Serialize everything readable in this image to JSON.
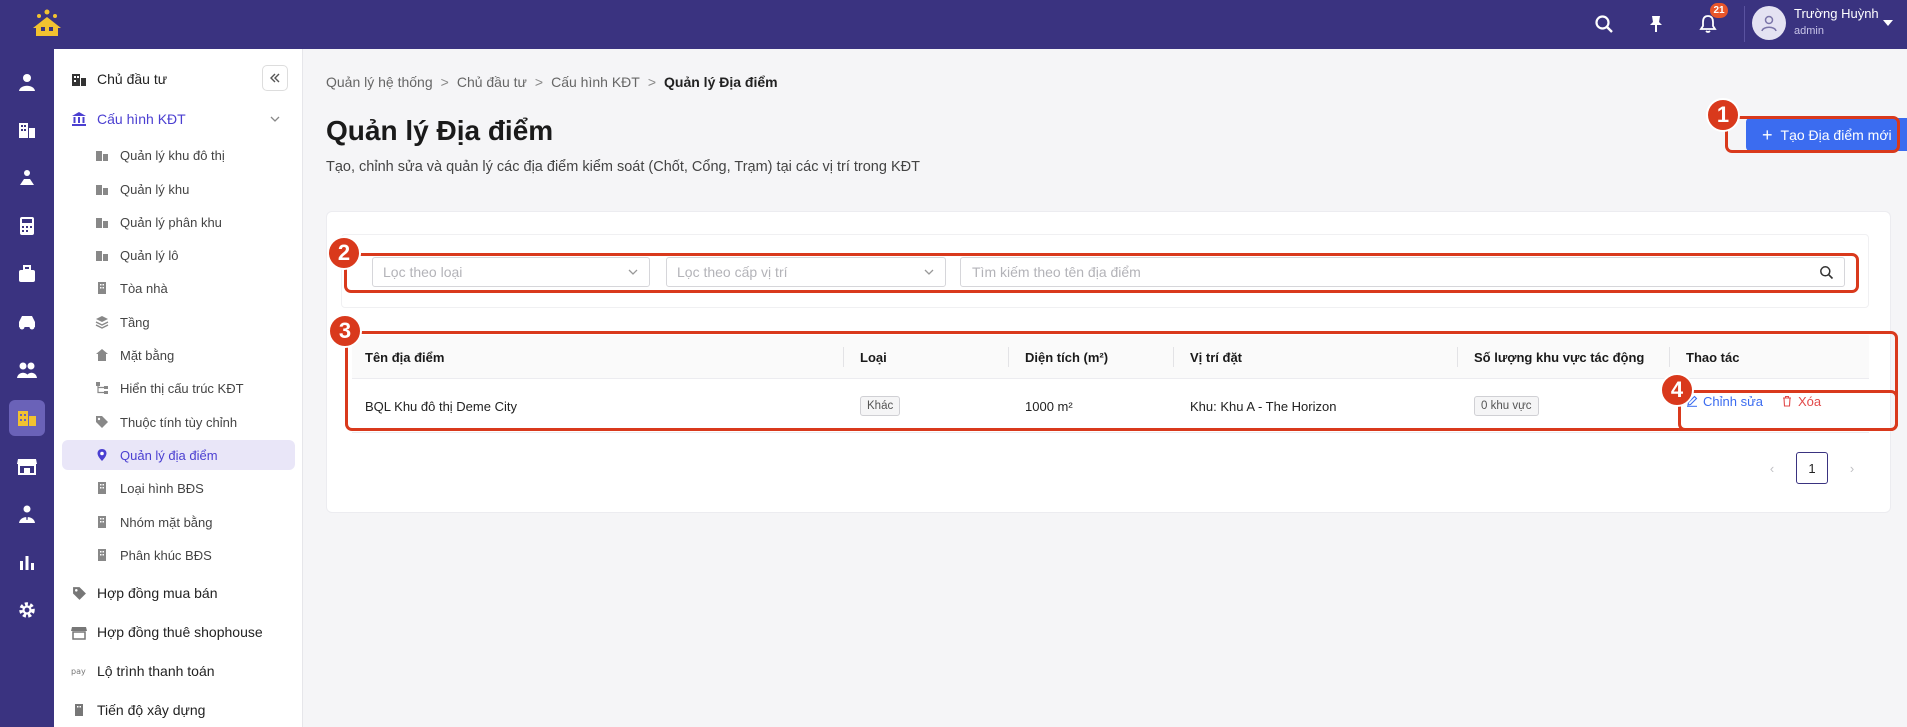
{
  "user": {
    "name": "Trường Huỳnh",
    "role": "admin",
    "notification_count": "21"
  },
  "sidebar": {
    "investor": "Chủ đầu tư",
    "group_label": "Cấu hình KĐT",
    "sub_items": [
      "Quản lý khu đô thị",
      "Quản lý khu",
      "Quản lý phân khu",
      "Quản lý lô",
      "Tòa nhà",
      "Tầng",
      "Mặt bằng",
      "Hiển thị cấu trúc KĐT",
      "Thuộc tính tùy chỉnh",
      "Quản lý địa điểm",
      "Loại hình BĐS",
      "Nhóm mặt bằng",
      "Phân khúc BĐS"
    ],
    "bottom_items": [
      "Hợp đồng mua bán",
      "Hợp đồng thuê shophouse",
      "Lộ trình thanh toán",
      "Tiến độ xây dựng"
    ]
  },
  "breadcrumb": [
    "Quản lý hệ thống",
    "Chủ đầu tư",
    "Cấu hình KĐT",
    "Quản lý Địa điểm"
  ],
  "breadcrumb_sep": ">",
  "page": {
    "title": "Quản lý Địa điểm",
    "description": "Tạo, chỉnh sửa và quản lý các địa điểm kiểm soát (Chốt, Cổng, Trạm) tại các vị trí trong KĐT",
    "create_button": "Tạo Địa điểm mới",
    "create_plus": "+"
  },
  "filters": {
    "type_placeholder": "Lọc theo loại",
    "level_placeholder": "Lọc theo cấp vị trí",
    "search_placeholder": "Tìm kiếm theo tên địa điểm"
  },
  "table": {
    "headers": [
      "Tên địa điểm",
      "Loại",
      "Diện tích (m²)",
      "Vị trí đặt",
      "Số lượng khu vực tác động",
      "Thao tác"
    ],
    "rows": [
      {
        "name": "BQL Khu đô thị Deme City",
        "type": "Khác",
        "area": "1000 m²",
        "location": "Khu: Khu A - The Horizon",
        "zones": "0 khu vực"
      }
    ],
    "edit_label": "Chỉnh sửa",
    "delete_label": "Xóa"
  },
  "pagination": {
    "current": "1",
    "prev": "‹",
    "next": "›"
  },
  "annotations": [
    "1",
    "2",
    "3",
    "4"
  ],
  "colors": {
    "header_bg": "#3a3380",
    "accent": "#3b6cf0",
    "annotation": "#d9391c",
    "active_nav": "#4b3fd1"
  },
  "icons": {
    "topbar": [
      "search-icon",
      "pin-icon",
      "bell-icon",
      "user-icon",
      "caret-down-icon"
    ],
    "rail": [
      "person-icon",
      "building-icon",
      "handshake-icon",
      "calculator-icon",
      "briefcase-icon",
      "car-icon",
      "people-icon",
      "city-icon",
      "store-icon",
      "user-tie-icon",
      "chart-icon",
      "gear-icon"
    ]
  }
}
